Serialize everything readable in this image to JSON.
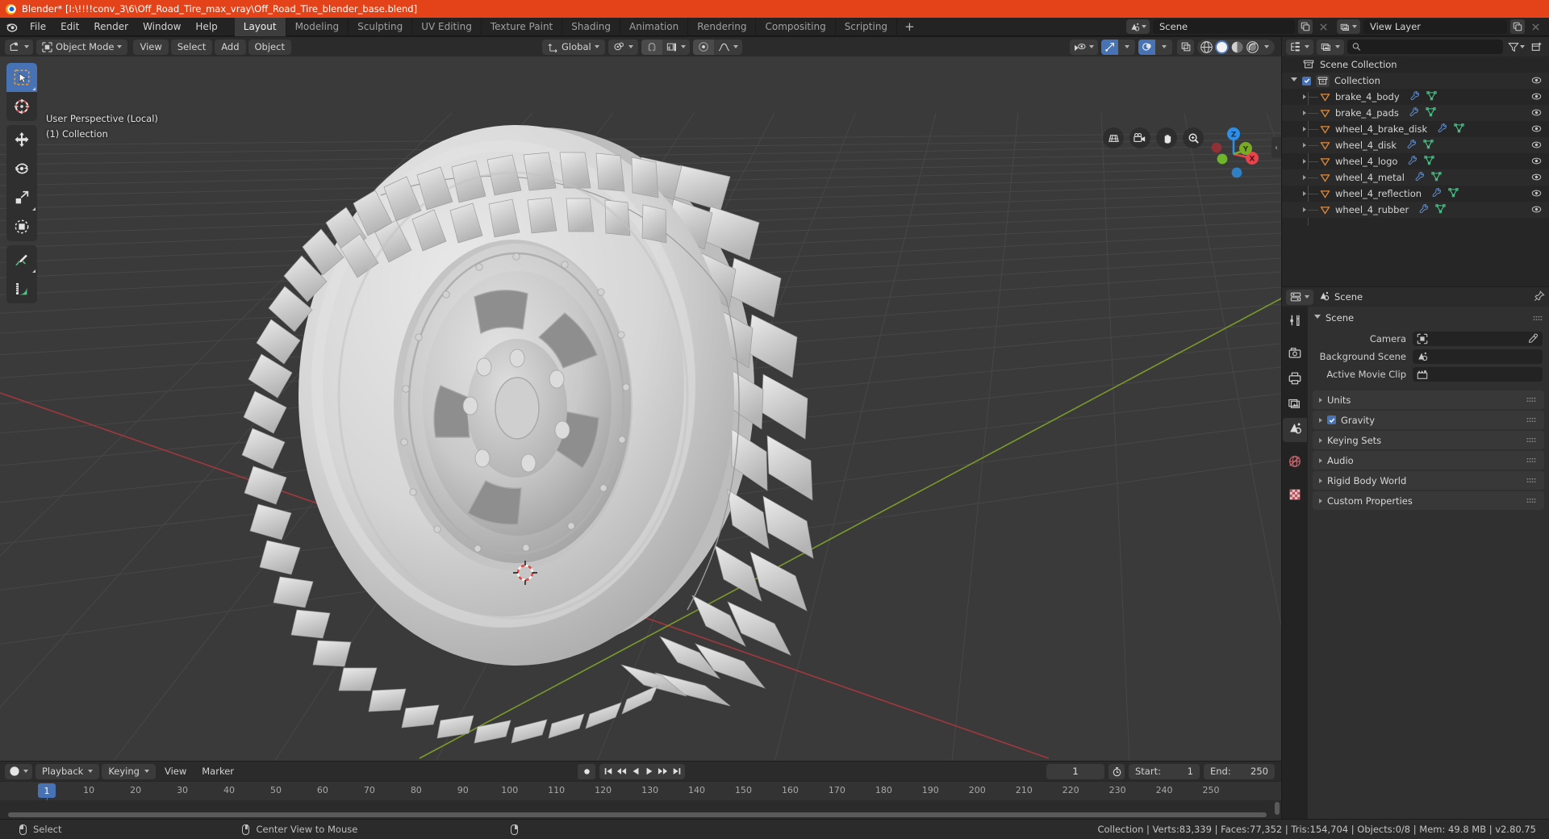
{
  "window": {
    "title": "Blender* [I:\\!!!!conv_3\\6\\Off_Road_Tire_max_vray\\Off_Road_Tire_blender_base.blend]",
    "app_icon": "blender-logo-icon"
  },
  "menubar": {
    "items": [
      "File",
      "Edit",
      "Render",
      "Window",
      "Help"
    ]
  },
  "workspace_tabs": {
    "active": "Layout",
    "items": [
      "Layout",
      "Modeling",
      "Sculpting",
      "UV Editing",
      "Texture Paint",
      "Shading",
      "Animation",
      "Rendering",
      "Compositing",
      "Scripting"
    ],
    "add_label": "+"
  },
  "topbar_right": {
    "scene_name": "Scene",
    "view_layer_name": "View Layer",
    "scene_icon": "scene-data-icon",
    "view_layer_icon": "view-layer-icon",
    "new_icon": "duplicate-icon",
    "remove_icon": "x-icon"
  },
  "viewport_header": {
    "editor_type_icon": "editor-type-3dview-icon",
    "mode": "Object Mode",
    "mode_icon": "object-mode-icon",
    "menus": [
      "View",
      "Select",
      "Add",
      "Object"
    ],
    "transform_orientation": "Global",
    "orientation_icon": "orientation-axes-icon",
    "pivot_icon": "pivot-point-icon",
    "snap_icon": "magnet-icon",
    "snap_target_icon": "snap-increment-icon",
    "proportional_icon": "proportional-edit-icon",
    "falloff_icon": "smooth-falloff-icon",
    "visibility_icon": "object-visibility-icon",
    "gizmo_icon": "gizmo-icon",
    "overlays_icon": "overlays-icon",
    "xray_icon": "xray-toggle-icon",
    "shading_modes": [
      "wireframe",
      "solid",
      "material-preview",
      "rendered"
    ],
    "shading_active": "solid"
  },
  "viewport": {
    "overlay_line1": "User Perspective (Local)",
    "overlay_line2": "(1) Collection",
    "tools": [
      {
        "name": "tweak-select-tool",
        "active": true
      },
      {
        "name": "cursor-tool",
        "active": false
      },
      {
        "name": "move-tool",
        "active": false
      },
      {
        "name": "rotate-tool",
        "active": false
      },
      {
        "name": "scale-tool",
        "active": false
      },
      {
        "name": "transform-tool",
        "active": false
      },
      {
        "name": "annotate-tool",
        "active": false
      },
      {
        "name": "measure-tool",
        "active": false
      }
    ],
    "nav_icons": [
      "zoom-region-icon",
      "camera-view-icon",
      "pan-view-icon",
      "zoom-view-icon"
    ],
    "gizmo_axes": [
      {
        "label": "Z",
        "color": "#2e8fe8"
      },
      {
        "label": "Y",
        "color": "#7aab27"
      },
      {
        "label": "X",
        "color": "#e8424a"
      },
      {
        "label": "",
        "color": "#8f3136"
      },
      {
        "label": "",
        "color": "#6db52a"
      },
      {
        "label": "",
        "color": "#2f7fc4"
      }
    ],
    "grid_color": "#4a4a4a",
    "bg_color": "#3a3a3a",
    "x_axis_color": "#a63b3f",
    "y_axis_color": "#7a9a2b"
  },
  "outliner": {
    "display_mode_icon": "outliner-display-mode-icon",
    "view_layer_icon": "view-layer-icon",
    "search_placeholder": "",
    "search_icon": "search-icon",
    "filter_icon": "filter-icon",
    "new_collection_icon": "new-collection-icon",
    "root": "Scene Collection",
    "collection": "Collection",
    "items": [
      {
        "name": "brake_4_body",
        "icon": "mesh-object-icon",
        "modifier_icon": "wrench-icon",
        "data_icon": "mesh-data-icon"
      },
      {
        "name": "brake_4_pads",
        "icon": "mesh-object-icon",
        "modifier_icon": "wrench-icon",
        "data_icon": "mesh-data-icon"
      },
      {
        "name": "wheel_4_brake_disk",
        "icon": "mesh-object-icon",
        "modifier_icon": "wrench-icon",
        "data_icon": "mesh-data-icon"
      },
      {
        "name": "wheel_4_disk",
        "icon": "mesh-object-icon",
        "modifier_icon": "wrench-icon",
        "data_icon": "mesh-data-icon"
      },
      {
        "name": "wheel_4_logo",
        "icon": "mesh-object-icon",
        "modifier_icon": "wrench-icon",
        "data_icon": "mesh-data-icon"
      },
      {
        "name": "wheel_4_metal",
        "icon": "mesh-object-icon",
        "modifier_icon": "wrench-icon",
        "data_icon": "mesh-data-icon"
      },
      {
        "name": "wheel_4_reflection",
        "icon": "mesh-object-icon",
        "modifier_icon": "wrench-icon",
        "data_icon": "mesh-data-icon"
      },
      {
        "name": "wheel_4_rubber",
        "icon": "mesh-object-icon",
        "modifier_icon": "wrench-icon",
        "data_icon": "mesh-data-icon"
      }
    ]
  },
  "properties": {
    "editor_icon": "properties-editor-icon",
    "breadcrumb_icon": "scene-properties-icon",
    "breadcrumb": "Scene",
    "pin_icon": "pin-icon",
    "tabs": [
      {
        "name": "tool-properties-tab",
        "icon": "tool-icon",
        "active": false
      },
      {
        "name": "render-properties-tab",
        "icon": "camera-back-icon",
        "active": false
      },
      {
        "name": "output-properties-tab",
        "icon": "printer-icon",
        "active": false
      },
      {
        "name": "view-layer-properties-tab",
        "icon": "images-icon",
        "active": false
      },
      {
        "name": "scene-properties-tab",
        "icon": "scene-cone-icon",
        "active": true
      },
      {
        "name": "world-properties-tab",
        "icon": "world-globe-icon",
        "active": false
      },
      {
        "name": "texture-properties-tab",
        "icon": "checker-texture-icon",
        "active": false
      }
    ],
    "scene_panel": {
      "title": "Scene",
      "rows": [
        {
          "label": "Camera",
          "value": "",
          "icon": "camera-data-icon",
          "has_eyedropper": true
        },
        {
          "label": "Background Scene",
          "value": "",
          "icon": "scene-data-icon",
          "has_eyedropper": false
        },
        {
          "label": "Active Movie Clip",
          "value": "",
          "icon": "movie-clip-icon",
          "has_eyedropper": false
        }
      ]
    },
    "panels": [
      {
        "label": "Units",
        "checkbox": null
      },
      {
        "label": "Gravity",
        "checkbox": true
      },
      {
        "label": "Keying Sets",
        "checkbox": null
      },
      {
        "label": "Audio",
        "checkbox": null
      },
      {
        "label": "Rigid Body World",
        "checkbox": null
      },
      {
        "label": "Custom Properties",
        "checkbox": null
      }
    ]
  },
  "timeline": {
    "editor_icon": "timeline-editor-icon",
    "menus": [
      "Playback",
      "Keying",
      "View",
      "Marker"
    ],
    "menus_with_chevron": [
      "Playback",
      "Keying"
    ],
    "record_icon": "record-icon",
    "transport_icons": [
      "jump-start-icon",
      "prev-keyframe-icon",
      "play-reverse-icon",
      "play-icon",
      "next-keyframe-icon",
      "jump-end-icon"
    ],
    "current_frame": "1",
    "autokey_icon": "auto-keying-icon",
    "start_label": "Start:",
    "start_value": "1",
    "end_label": "End:",
    "end_value": "250",
    "ruler_ticks": [
      10,
      20,
      30,
      40,
      50,
      60,
      70,
      80,
      90,
      100,
      110,
      120,
      130,
      140,
      150,
      160,
      170,
      180,
      190,
      200,
      210,
      220,
      230,
      240,
      250
    ],
    "playhead_frame": "1",
    "playhead_color": "#4772b3"
  },
  "statusbar": {
    "left_items": [
      {
        "icon": "mouse-left-icon",
        "label": "Select"
      },
      {
        "icon": "mouse-middle-icon",
        "label": "Center View to Mouse"
      },
      {
        "icon": "mouse-right-icon",
        "label": ""
      }
    ],
    "stats": "Collection | Verts:83,339 | Faces:77,352 | Tris:154,704 | Objects:0/8 | Mem: 49.8 MB | v2.80.75"
  },
  "colors": {
    "accent": "#4772b3",
    "title_bar": "#e4431a",
    "panel_bg": "#2b2b2b",
    "editor_bg": "#303030",
    "outliner_bg": "#262626",
    "orange_object": "#e08a3c",
    "green_mesh": "#46c98b"
  }
}
